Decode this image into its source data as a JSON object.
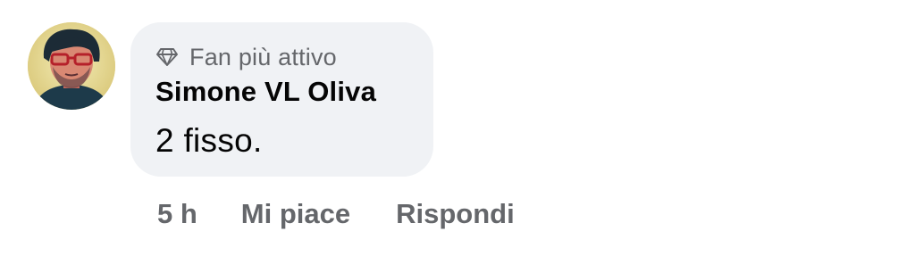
{
  "comment": {
    "avatar_icon": "user-avatar-photo",
    "badge": {
      "icon": "diamond-icon",
      "label": "Fan più attivo"
    },
    "author": "Simone VL Oliva",
    "text": "2 fisso.",
    "actions": {
      "time": "5 h",
      "like_label": "Mi piace",
      "reply_label": "Rispondi"
    }
  },
  "colors": {
    "bubble_bg": "#f0f2f5",
    "primary_text": "#050505",
    "secondary_text": "#65676b"
  }
}
